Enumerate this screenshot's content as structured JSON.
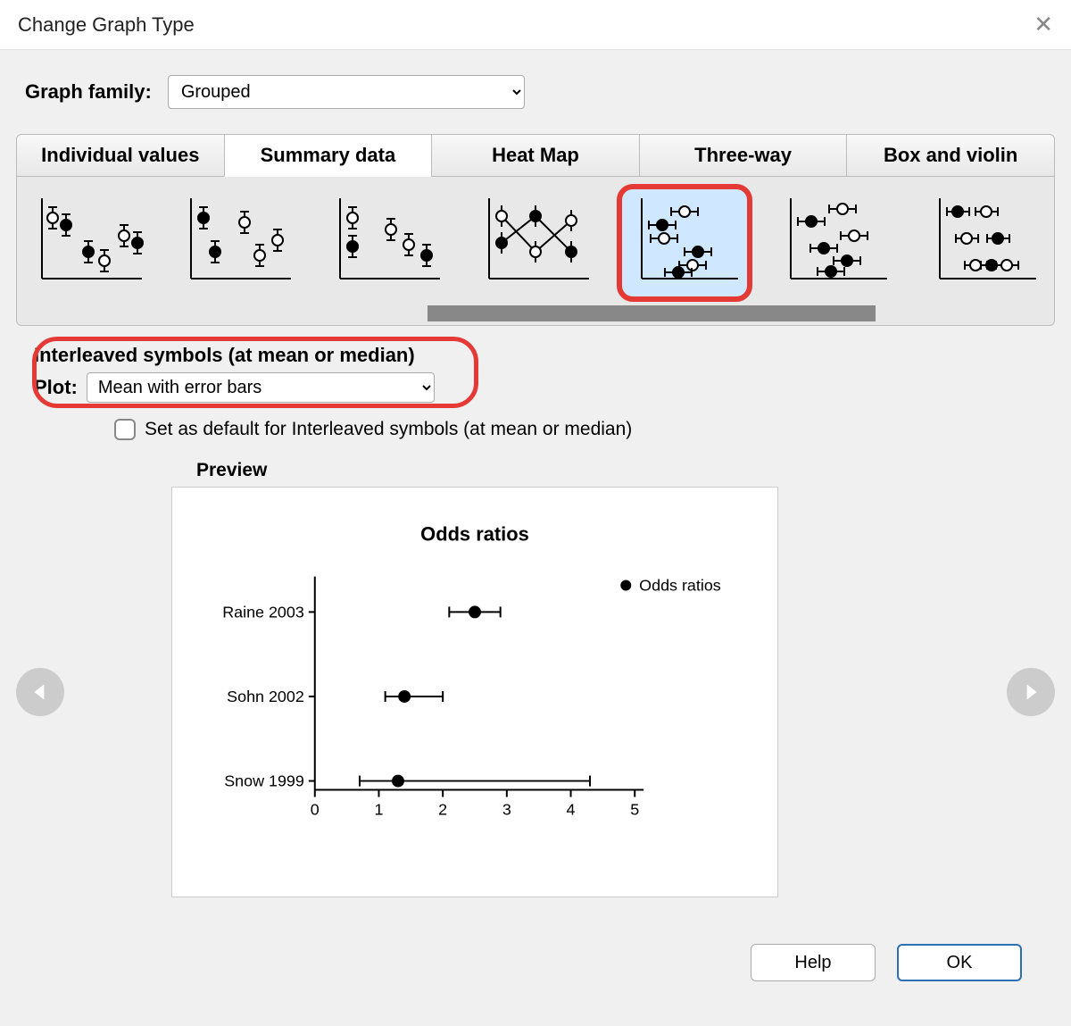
{
  "window": {
    "title": "Change Graph Type"
  },
  "family": {
    "label": "Graph family:",
    "value": "Grouped"
  },
  "tabs": [
    "Individual values",
    "Summary data",
    "Heat Map",
    "Three-way",
    "Box and violin"
  ],
  "active_tab_index": 1,
  "selected_thumb_index": 4,
  "settings": {
    "section_title": "Interleaved symbols (at mean or median)",
    "plot_label": "Plot:",
    "plot_value": "Mean with error bars",
    "default_checkbox_label": "Set as default for Interleaved symbols (at mean or median)",
    "default_checked": false
  },
  "preview": {
    "label": "Preview"
  },
  "buttons": {
    "help": "Help",
    "ok": "OK"
  },
  "chart_data": {
    "type": "scatter",
    "title": "Odds ratios",
    "legend": "Odds ratios",
    "xlabel": "",
    "ylabel": "",
    "xlim": [
      0,
      5
    ],
    "xticks": [
      0,
      1,
      2,
      3,
      4,
      5
    ],
    "categories": [
      "Raine 2003",
      "Sohn 2002",
      "Snow 1999"
    ],
    "series": [
      {
        "name": "Odds ratios",
        "points": [
          {
            "label": "Raine 2003",
            "value": 2.5,
            "low": 2.1,
            "high": 2.9
          },
          {
            "label": "Sohn 2002",
            "value": 1.4,
            "low": 1.1,
            "high": 2.0
          },
          {
            "label": "Snow 1999",
            "value": 1.3,
            "low": 0.7,
            "high": 4.3
          }
        ]
      }
    ]
  }
}
